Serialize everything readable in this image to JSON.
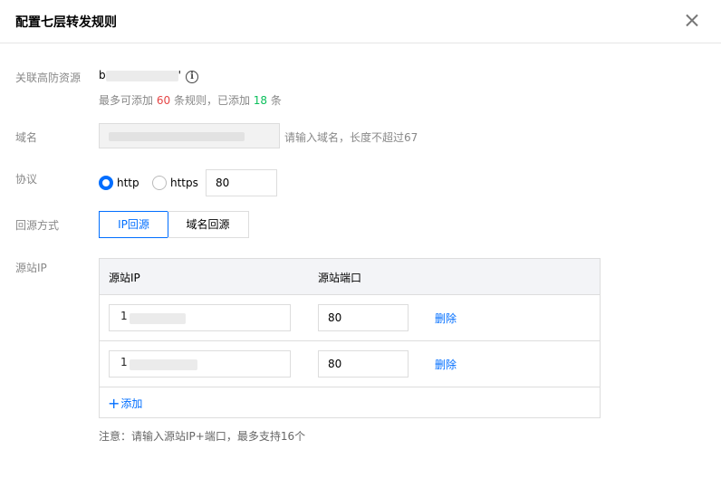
{
  "dialog": {
    "title": "配置七层转发规则"
  },
  "resource": {
    "label": "关联高防资源",
    "value_prefix": "b",
    "value_suffix": "'",
    "quota_prefix": "最多可添加",
    "max_rules": "60",
    "quota_mid": "条规则，已添加",
    "added_rules": "18",
    "quota_suffix": "条"
  },
  "domain": {
    "label": "域名",
    "hint": "请输入域名，长度不超过67"
  },
  "protocol": {
    "label": "协议",
    "options": [
      "http",
      "https"
    ],
    "selected": "http",
    "port": "80"
  },
  "origin_mode": {
    "label": "回源方式",
    "options": [
      "IP回源",
      "域名回源"
    ],
    "selected": "IP回源"
  },
  "origin_ip": {
    "label": "源站IP",
    "columns": [
      "源站IP",
      "源站端口"
    ],
    "rows": [
      {
        "ip_prefix": "1",
        "port": "80",
        "action": "删除"
      },
      {
        "ip_prefix": "1",
        "port": "80",
        "action": "删除"
      }
    ],
    "add_label": "添加",
    "note": "注意：请输入源站IP+端口，最多支持16个"
  },
  "colors": {
    "accent": "#006eff",
    "max_rules": "#e54545",
    "added_rules": "#0abf5b"
  }
}
